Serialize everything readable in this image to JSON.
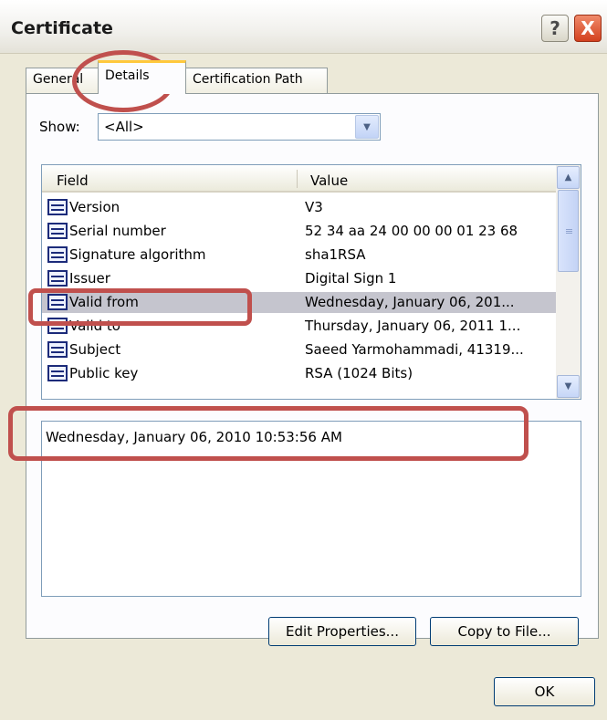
{
  "window": {
    "title": "Certificate",
    "help_symbol": "?",
    "close_symbol": "X"
  },
  "tabs": [
    {
      "label": "General"
    },
    {
      "label": "Details"
    },
    {
      "label": "Certification Path"
    }
  ],
  "show": {
    "label": "Show:",
    "selected": "<All>"
  },
  "list": {
    "columns": [
      "Field",
      "Value"
    ],
    "rows": [
      {
        "field": "Version",
        "value": "V3"
      },
      {
        "field": "Serial number",
        "value": "52 34 aa 24 00 00 00 01 23 68"
      },
      {
        "field": "Signature algorithm",
        "value": "sha1RSA"
      },
      {
        "field": "Issuer",
        "value": "Digital Sign 1"
      },
      {
        "field": "Valid from",
        "value": "Wednesday, January 06, 201..."
      },
      {
        "field": "Valid to",
        "value": "Thursday, January 06, 2011 1..."
      },
      {
        "field": "Subject",
        "value": "Saeed Yarmohammadi, 41319..."
      },
      {
        "field": "Public key",
        "value": "RSA (1024 Bits)"
      }
    ],
    "selected_field": "Valid from"
  },
  "detail": {
    "text": "Wednesday, January 06, 2010 10:53:56 AM"
  },
  "buttons": {
    "edit": "Edit Properties...",
    "copy": "Copy to File...",
    "ok": "OK"
  },
  "icons": {
    "row_icon": "certificate-field-icon",
    "scroll_up": "chevron-up-icon",
    "scroll_down": "chevron-down-icon",
    "combo": "chevron-down-icon"
  },
  "colors": {
    "annotation": "#c0504d",
    "selection": "#c5c5ce",
    "tab_accent": "#ffc83d"
  }
}
